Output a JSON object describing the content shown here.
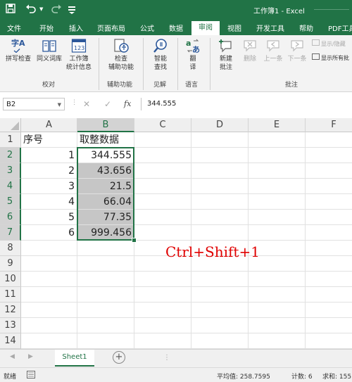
{
  "window": {
    "title": "工作簿1 - Excel",
    "save_icon": "save-icon",
    "undo_icon": "undo-icon",
    "redo_icon": "redo-icon",
    "customize_icon": "customize-quick-access-icon"
  },
  "tabs": [
    "文件",
    "开始",
    "插入",
    "页面布局",
    "公式",
    "数据",
    "审阅",
    "视图",
    "开发工具",
    "帮助",
    "PDF工具"
  ],
  "active_tab": "审阅",
  "ribbon": {
    "buttons": {
      "spell": "拼写检查",
      "thesaurus": "同义词库",
      "stats_l1": "工作簿",
      "stats_l2": "统计信息",
      "access_l1": "检查",
      "access_l2": "辅助功能",
      "smart_l1": "智能",
      "smart_l2": "查找",
      "translate_l1": "翻",
      "translate_l2": "译",
      "newcomment_l1": "新建",
      "newcomment_l2": "批注",
      "delete": "删除",
      "prev": "上一条",
      "next": "下一条",
      "show_hide": "显示/隐藏",
      "show_all": "显示所有批"
    },
    "groups": {
      "proofing": "校对",
      "accessibility": "辅助功能",
      "insights": "见解",
      "language": "语言",
      "comments": "批注"
    },
    "zi_glyph": "字A"
  },
  "formula_bar": {
    "name_box": "B2",
    "cancel": "✕",
    "confirm": "✓",
    "fx": "fx",
    "value": "344.555"
  },
  "sheet": {
    "columns": [
      "A",
      "B",
      "C",
      "D",
      "E",
      "F"
    ],
    "rows": [
      "1",
      "2",
      "3",
      "4",
      "5",
      "6",
      "7",
      "8",
      "9",
      "10",
      "11",
      "12",
      "13",
      "14"
    ],
    "header_row": {
      "a": "序号",
      "b": "取整数据"
    },
    "data": [
      {
        "a": "1",
        "b": "344.555"
      },
      {
        "a": "2",
        "b": "43.656"
      },
      {
        "a": "3",
        "b": "21.5"
      },
      {
        "a": "4",
        "b": "66.04"
      },
      {
        "a": "5",
        "b": "77.35"
      },
      {
        "a": "6",
        "b": "999.456"
      }
    ],
    "annotation": "Ctrl+Shift+1"
  },
  "sheet_tabs": {
    "active": "Sheet1",
    "add": "+"
  },
  "status_bar": {
    "ready": "就绪",
    "average": "平均值: 258.7595",
    "count": "计数: 6",
    "sum": "求和: 155"
  },
  "colors": {
    "excel_green": "#217346",
    "annotation_red": "#e00000"
  }
}
